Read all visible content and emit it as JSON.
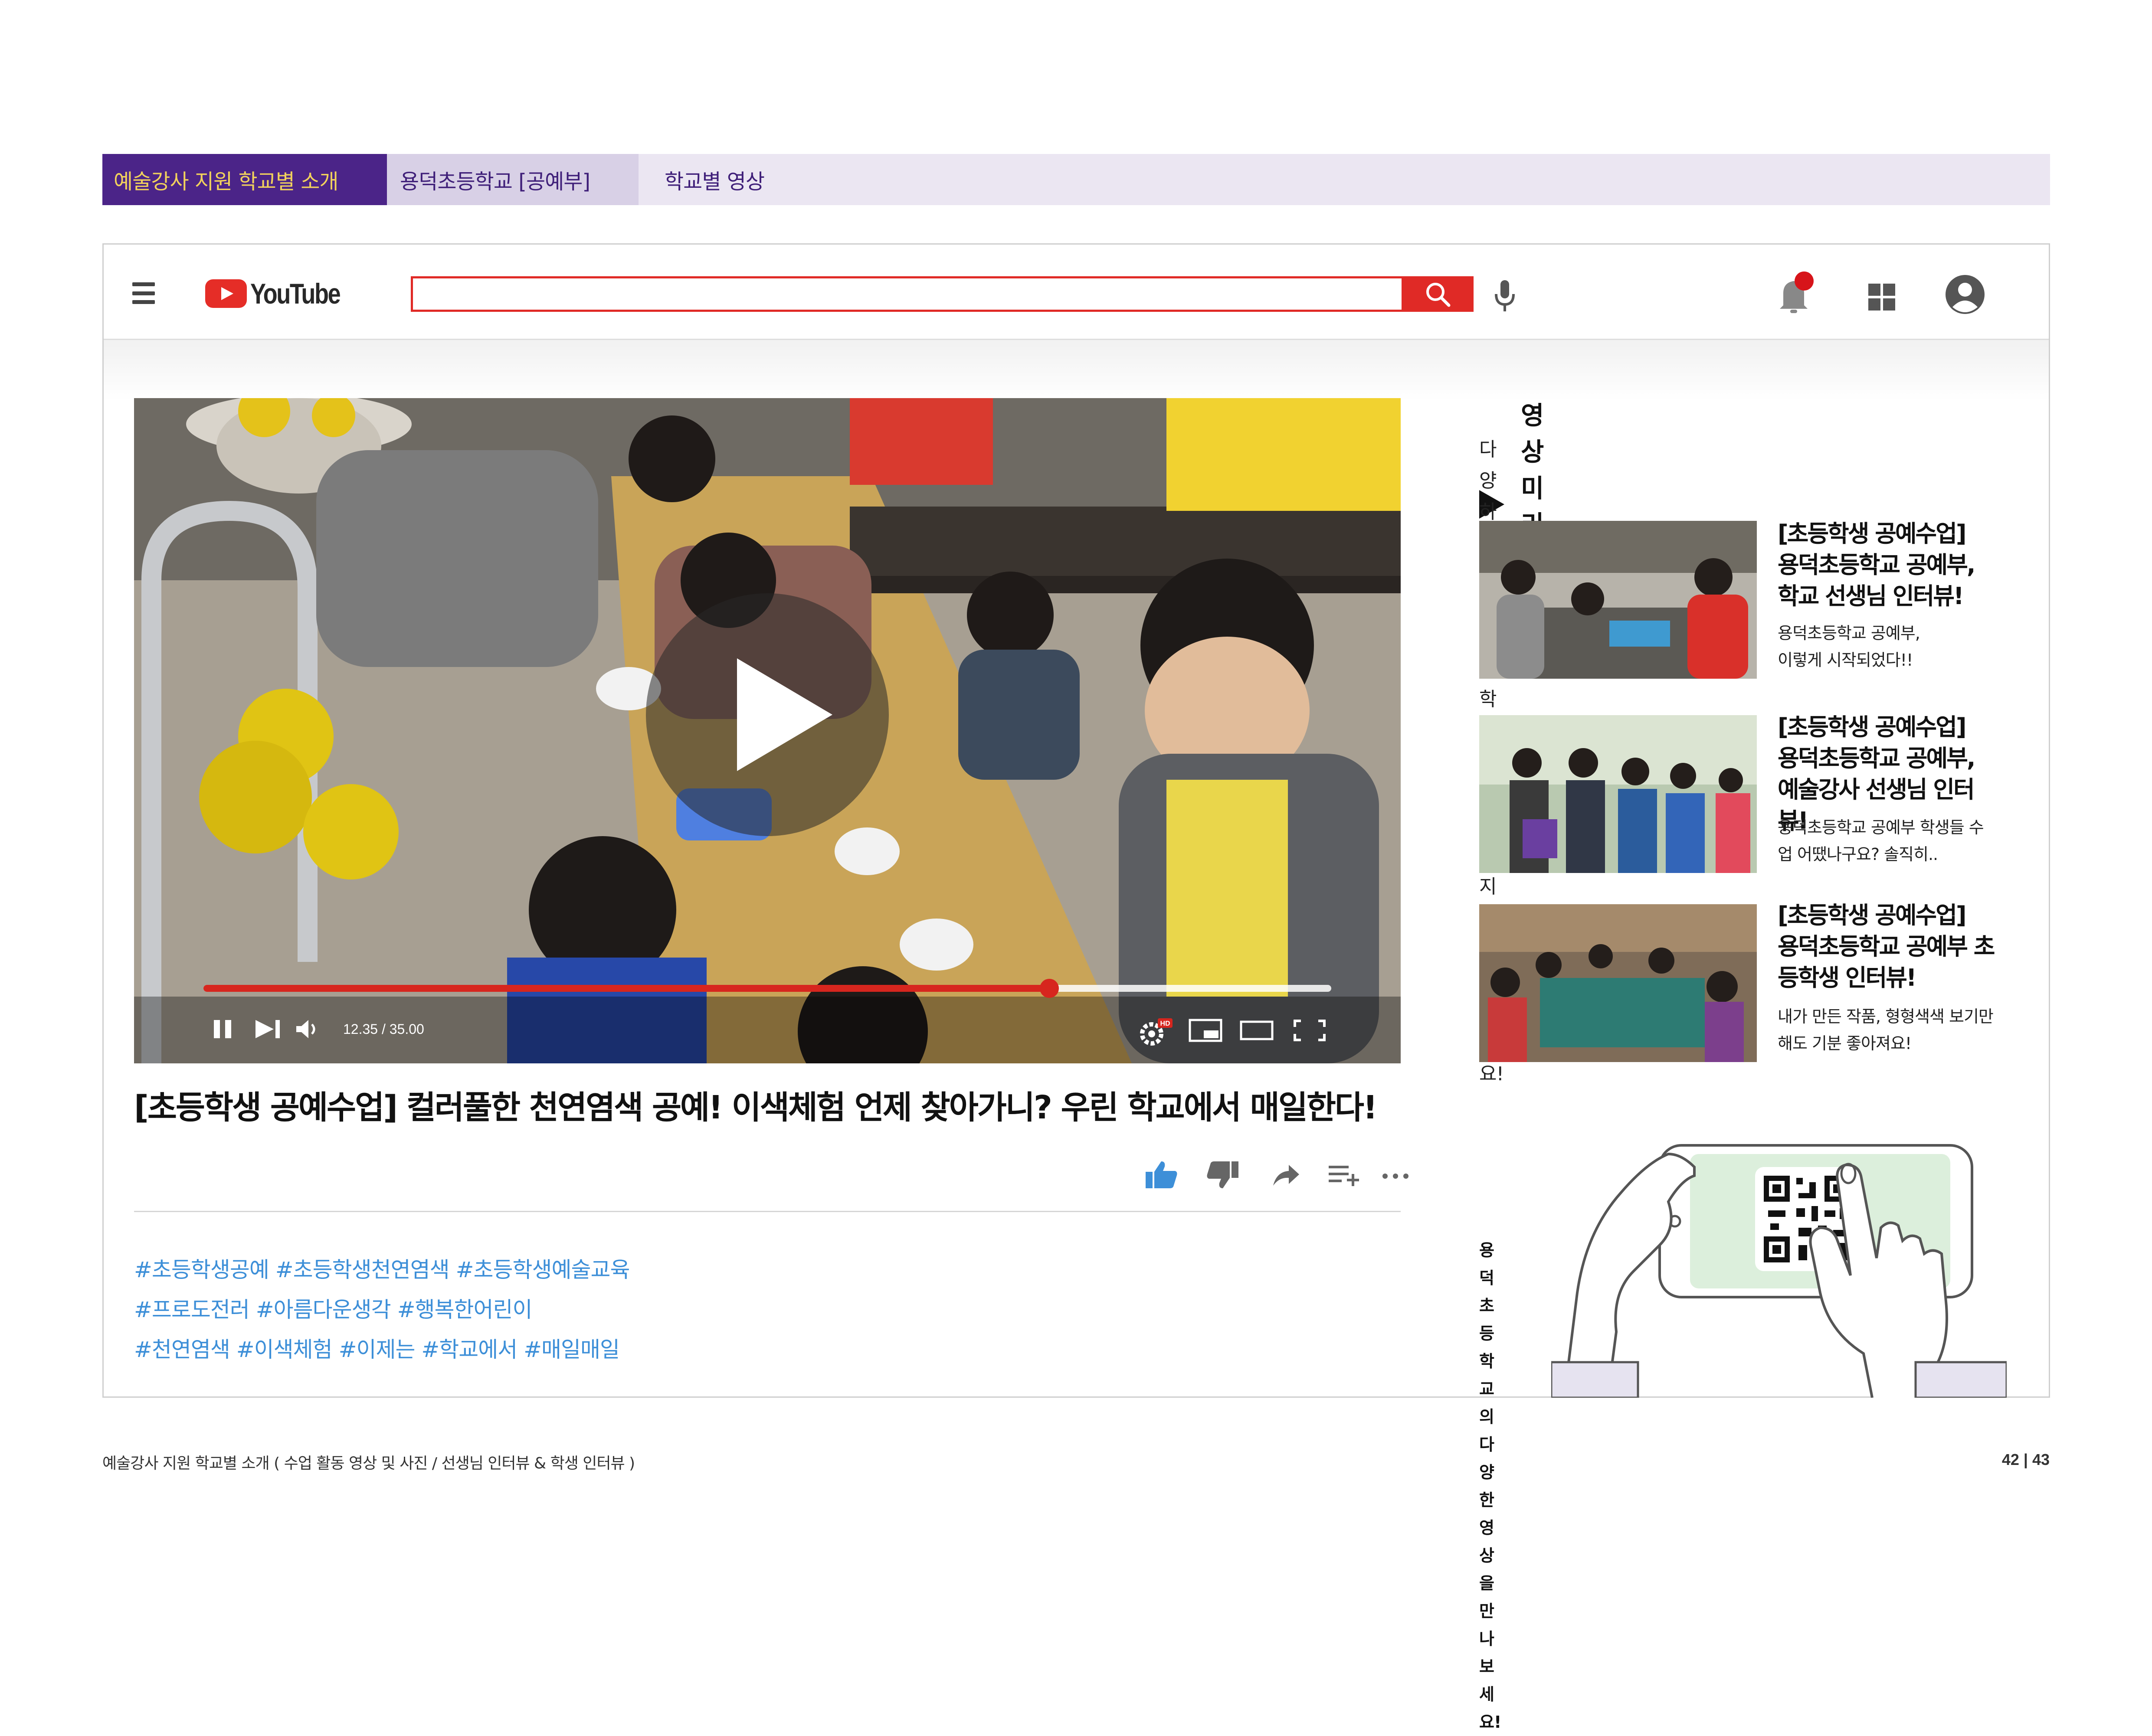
{
  "breadcrumb": {
    "section": "예술강사 지원 학교별 소개",
    "school": "용덕초등학교 [공예부]",
    "page": "학교별 영상"
  },
  "app": {
    "brand": "YouTube",
    "brand_color": "#e52d27",
    "search_placeholder": ""
  },
  "player": {
    "time": "12.35 / 35.00",
    "progress": 0.75,
    "quality_badge": "HD"
  },
  "video": {
    "title": "[초등학생 공예수업] 컬러풀한 천연염색 공예! 이색체험 언제 찾아가니? 우린 학교에서 매일한다!",
    "hashtags": [
      "#초등학생공예 #초등학생천연염색 #초등학생예술교육",
      "#프로도전러 #아름다운생각 #행복한어린이",
      "#천연염색 #이색체험 #이제는 #학교에서 #매일매일"
    ]
  },
  "sidebar": {
    "heading": "영상 미리보기",
    "desc_line1": "다양하고 매력적인 학교예술교육!",
    "desc_line2": "지금 만나보세요!",
    "cards": [
      {
        "title": [
          "[초등학생 공예수업]",
          "용덕초등학교 공예부,",
          "학교 선생님 인터뷰!"
        ],
        "sub": [
          "용덕초등학교 공예부,",
          "이렇게 시작되었다!!"
        ]
      },
      {
        "title": [
          "[초등학생 공예수업]",
          "용덕초등학교 공예부,",
          "예술강사 선생님 인터뷰!"
        ],
        "sub": [
          "용덕초등학교 공예부 학생들 수",
          "업 어땠나구요? 솔직히.."
        ]
      },
      {
        "title": [
          "[초등학생 공예수업]",
          "용덕초등학교 공예부 초",
          "등학생 인터뷰!"
        ],
        "sub": [
          "내가 만든 작품, 형형색색 보기만",
          "해도 기분 좋아져요!"
        ]
      }
    ],
    "qr_caption_line1": "용덕초등학교의",
    "qr_caption_line2": "다양한 영상을 만나보세요!"
  },
  "footer": {
    "left": "예술강사 지원 학교별 소개 ( 수업 활동 영상 및 사진 / 선생님 인터뷰 & 학생 인터뷰 )",
    "right": "42 | 43"
  },
  "icons": [
    "hamburger-icon",
    "search-icon",
    "mic-icon",
    "bell-icon",
    "apps-icon",
    "account-icon",
    "play-icon",
    "pause-icon",
    "next-icon",
    "volume-icon",
    "settings-icon",
    "miniplayer-icon",
    "theater-icon",
    "fullscreen-icon",
    "like-icon",
    "dislike-icon",
    "share-icon",
    "save-playlist-icon",
    "more-icon"
  ]
}
